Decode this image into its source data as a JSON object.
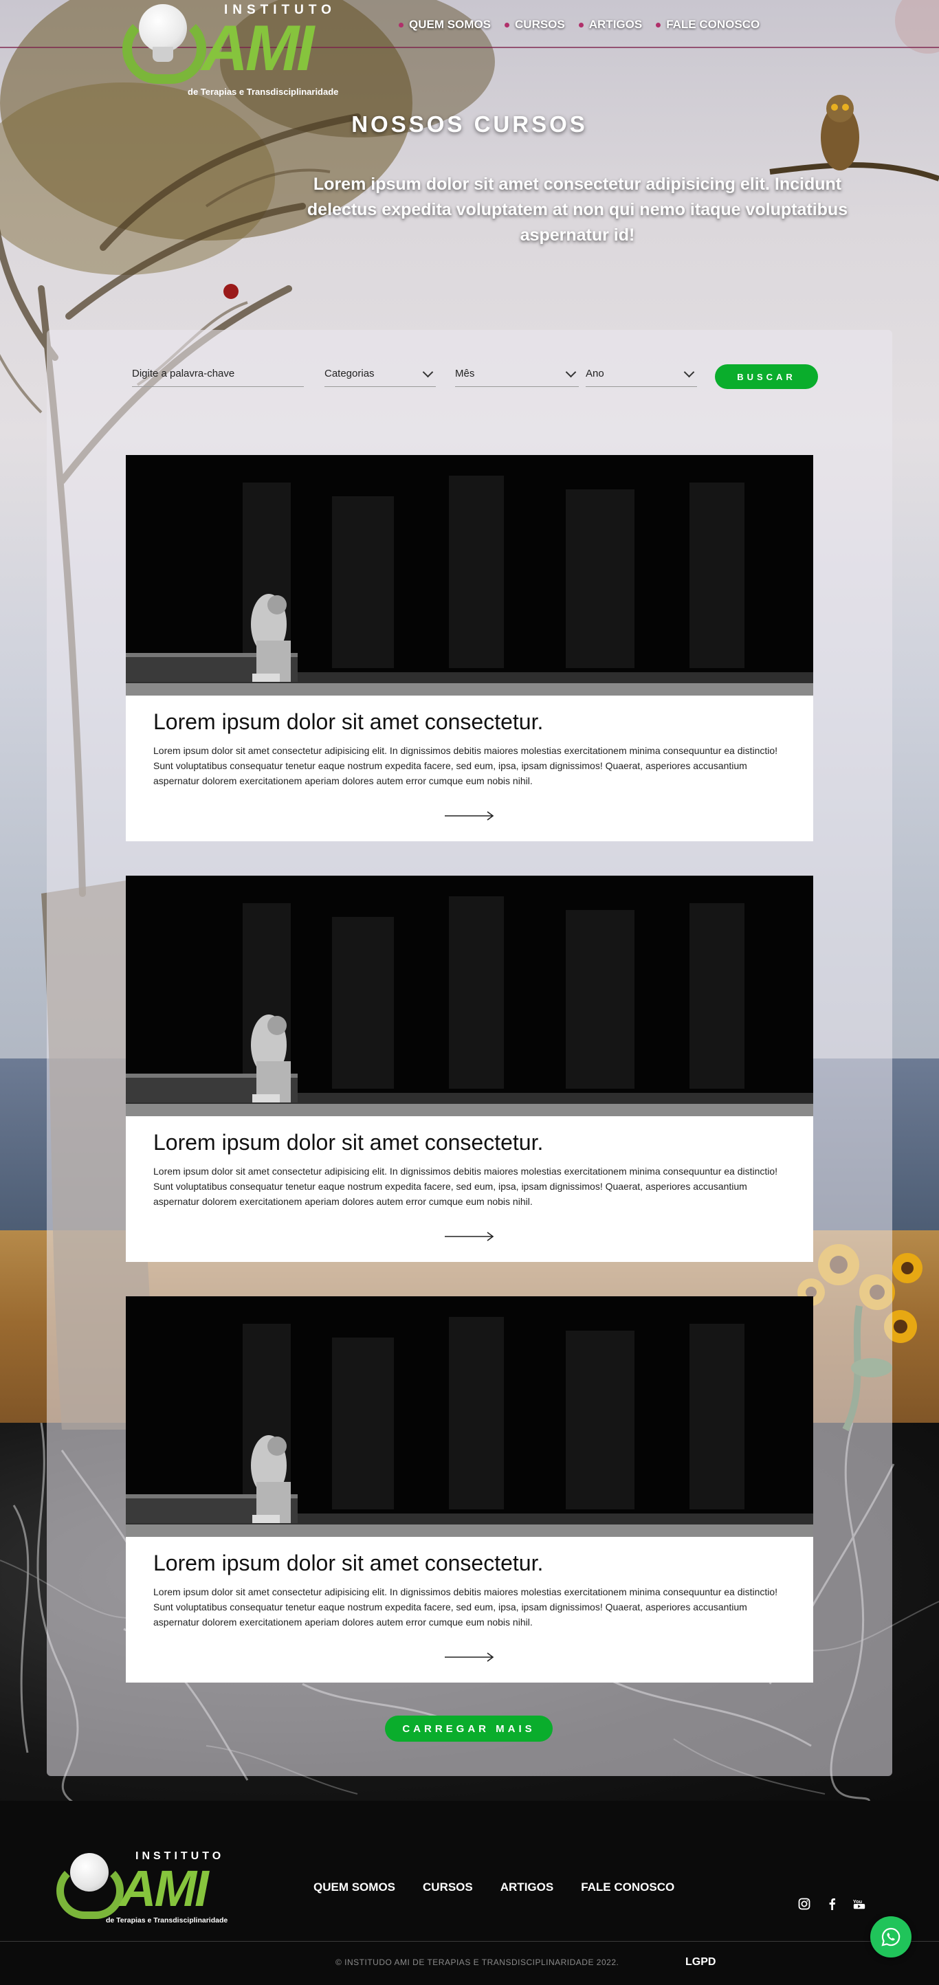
{
  "header": {
    "logo": {
      "top": "INSTITUTO",
      "main": "AMI",
      "subtitle": "de Terapias e Transdisciplinaridade"
    },
    "nav": [
      {
        "label": "QUEM SOMOS"
      },
      {
        "label": "CURSOS"
      },
      {
        "label": "ARTIGOS"
      },
      {
        "label": "FALE CONOSCO"
      }
    ]
  },
  "hero": {
    "title": "NOSSOS CURSOS",
    "text": "Lorem ipsum dolor sit amet consectetur adipisicing elit. Incidunt delectus expedita voluptatem at non qui nemo itaque voluptatibus aspernatur id!"
  },
  "search": {
    "keyword_placeholder": "Digite a palavra-chave",
    "category_label": "Categorias",
    "month_label": "Mês",
    "year_label": "Ano",
    "button_label": "BUSCAR"
  },
  "courses": [
    {
      "title": "Lorem ipsum dolor sit amet consectetur.",
      "text": "Lorem ipsum dolor sit amet consectetur adipisicing elit. In dignissimos debitis maiores molestias exercitationem minima consequuntur ea distinctio! Sunt voluptatibus consequatur tenetur eaque nostrum expedita facere, sed eum, ipsa, ipsam dignissimos! Quaerat, asperiores accusantium aspernatur dolorem exercitationem aperiam dolores autem error cumque eum nobis nihil."
    },
    {
      "title": "Lorem ipsum dolor sit amet consectetur.",
      "text": "Lorem ipsum dolor sit amet consectetur adipisicing elit. In dignissimos debitis maiores molestias exercitationem minima consequuntur ea distinctio! Sunt voluptatibus consequatur tenetur eaque nostrum expedita facere, sed eum, ipsa, ipsam dignissimos! Quaerat, asperiores accusantium aspernatur dolorem exercitationem aperiam dolores autem error cumque eum nobis nihil."
    },
    {
      "title": "Lorem ipsum dolor sit amet consectetur.",
      "text": "Lorem ipsum dolor sit amet consectetur adipisicing elit. In dignissimos debitis maiores molestias exercitationem minima consequuntur ea distinctio! Sunt voluptatibus consequatur tenetur eaque nostrum expedita facere, sed eum, ipsa, ipsam dignissimos! Quaerat, asperiores accusantium aspernatur dolorem exercitationem aperiam dolores autem error cumque eum nobis nihil."
    }
  ],
  "load_more_label": "CARREGAR MAIS",
  "footer": {
    "logo": {
      "top": "INSTITUTO",
      "main": "AMI",
      "subtitle": "de Terapias e Transdisciplinaridade"
    },
    "nav": [
      {
        "label": "QUEM SOMOS"
      },
      {
        "label": "CURSOS"
      },
      {
        "label": "ARTIGOS"
      },
      {
        "label": "FALE CONOSCO"
      }
    ],
    "social": [
      {
        "icon": "instagram-icon"
      },
      {
        "icon": "facebook-icon"
      },
      {
        "icon": "youtube-icon",
        "text": "You"
      }
    ],
    "copyright": "© INSTITUDO AMI DE TERAPIAS E TRANSDISCIPLINARIDADE 2022.",
    "lgpd": "LGPD"
  },
  "colors": {
    "accent_green": "#0aad2c",
    "logo_green": "#86c43d",
    "nav_dot": "#b0306a",
    "whatsapp": "#20c45a"
  }
}
